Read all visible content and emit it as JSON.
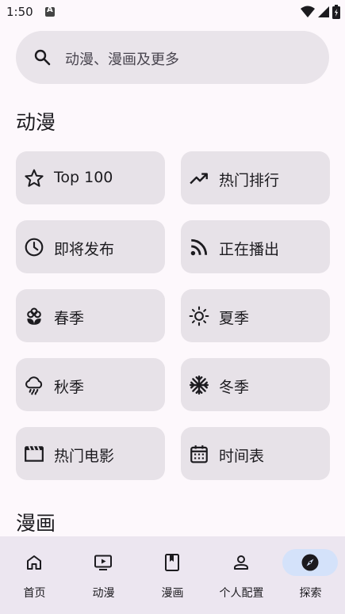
{
  "status": {
    "time": "1:50"
  },
  "search": {
    "placeholder": "动漫、漫画及更多",
    "icon": "search-icon"
  },
  "sections": {
    "anime_title": "动漫",
    "manga_title": "漫画"
  },
  "tiles": [
    {
      "label": "Top 100",
      "icon": "star-icon"
    },
    {
      "label": "热门排行",
      "icon": "trending-up-icon"
    },
    {
      "label": "即将发布",
      "icon": "clock-icon"
    },
    {
      "label": "正在播出",
      "icon": "rss-icon"
    },
    {
      "label": "春季",
      "icon": "flower-icon"
    },
    {
      "label": "夏季",
      "icon": "sun-icon"
    },
    {
      "label": "秋季",
      "icon": "rain-cloud-icon"
    },
    {
      "label": "冬季",
      "icon": "snowflake-icon"
    },
    {
      "label": "热门电影",
      "icon": "movie-icon"
    },
    {
      "label": "时间表",
      "icon": "calendar-icon"
    }
  ],
  "bottom_nav": {
    "items": [
      {
        "label": "首页",
        "icon": "home-icon"
      },
      {
        "label": "动漫",
        "icon": "tv-play-icon"
      },
      {
        "label": "漫画",
        "icon": "book-icon"
      },
      {
        "label": "个人配置",
        "icon": "person-icon"
      },
      {
        "label": "探索",
        "icon": "compass-icon",
        "active": true
      }
    ],
    "active_color": "#d4e2fa"
  }
}
